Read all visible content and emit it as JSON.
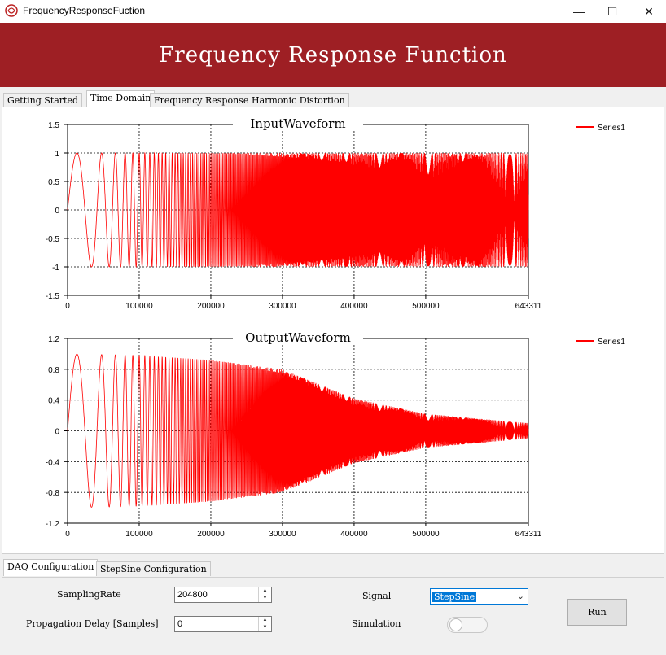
{
  "window": {
    "title": "FrequencyResponseFuction",
    "icon": "app-logo-icon",
    "minimize_icon": "minimize-icon",
    "maximize_icon": "maximize-icon",
    "close_icon": "close-icon"
  },
  "banner": {
    "title": "Frequency Response Function",
    "color": "#9e1f24"
  },
  "main_tabs": [
    {
      "label": "Getting Started",
      "active": false
    },
    {
      "label": "Time Domain",
      "active": true
    },
    {
      "label": "Frequency Response",
      "active": false
    },
    {
      "label": "Harmonic Distortion",
      "active": false
    }
  ],
  "chart_data": [
    {
      "type": "line",
      "title": "InputWaveform",
      "xlim": [
        0,
        643311
      ],
      "ylim": [
        -1.5,
        1.5
      ],
      "xticks": [
        "0",
        "100000",
        "200000",
        "300000",
        "400000",
        "500000",
        "643311"
      ],
      "yticks": [
        "1.5",
        "1",
        "0.5",
        "0",
        "-0.5",
        "-1",
        "-1.5"
      ],
      "grid": true,
      "legend_position": "top-right",
      "series": [
        {
          "name": "Series1",
          "color": "#ff0000",
          "description_shape": "swept sine, amplitude 1, increasing frequency",
          "envelope": [
            {
              "x": 0,
              "y": 1
            },
            {
              "x": 643311,
              "y": 1
            }
          ]
        }
      ]
    },
    {
      "type": "line",
      "title": "OutputWaveform",
      "xlim": [
        0,
        643311
      ],
      "ylim": [
        -1.2,
        1.2
      ],
      "xticks": [
        "0",
        "100000",
        "200000",
        "300000",
        "400000",
        "500000",
        "643311"
      ],
      "yticks": [
        "1.2",
        "0.8",
        "0.4",
        "0",
        "-0.4",
        "-0.8",
        "-1.2"
      ],
      "grid": true,
      "legend_position": "top-right",
      "series": [
        {
          "name": "Series1",
          "color": "#ff0000",
          "envelope": [
            {
              "x": 0,
              "y": 1.0
            },
            {
              "x": 100000,
              "y": 0.98
            },
            {
              "x": 200000,
              "y": 0.92
            },
            {
              "x": 300000,
              "y": 0.8
            },
            {
              "x": 400000,
              "y": 0.42
            },
            {
              "x": 500000,
              "y": 0.22
            },
            {
              "x": 643311,
              "y": 0.1
            }
          ]
        }
      ]
    }
  ],
  "config_tabs": [
    {
      "label": "DAQ Configuration",
      "active": true
    },
    {
      "label": "StepSine Configuration",
      "active": false
    }
  ],
  "config": {
    "sampling_rate_label": "SamplingRate",
    "sampling_rate_value": "204800",
    "prop_delay_label": "Propagation Delay [Samples]",
    "prop_delay_value": "0",
    "signal_label": "Signal",
    "signal_value": "StepSine",
    "simulation_label": "Simulation",
    "simulation_on": false,
    "run_label": "Run"
  }
}
